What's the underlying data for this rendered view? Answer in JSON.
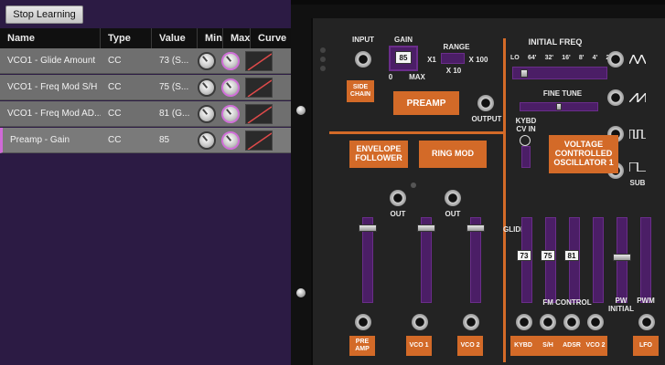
{
  "toolbar": {
    "stop_learning_label": "Stop Learning"
  },
  "table": {
    "headers": {
      "name": "Name",
      "type": "Type",
      "value": "Value",
      "min": "Min",
      "max": "Max",
      "curve": "Curve"
    },
    "rows": [
      {
        "name": "VCO1 - Glide Amount",
        "type": "CC",
        "value": "73 (S..."
      },
      {
        "name": "VCO1 - Freq Mod S/H ...",
        "type": "CC",
        "value": "75 (S..."
      },
      {
        "name": "VCO1 - Freq Mod AD...",
        "type": "CC",
        "value": "81 (G..."
      },
      {
        "name": "Preamp - Gain",
        "type": "CC",
        "value": "85"
      }
    ]
  },
  "synth": {
    "input_label": "INPUT",
    "gain_label": "GAIN",
    "gain_value": "85",
    "gain_min": "0",
    "gain_max": "MAX",
    "range_label": "RANGE",
    "range_x1": "X1",
    "range_x100": "X 100",
    "range_x10": "X 10",
    "side_chain_label": "SIDE CHAIN",
    "preamp_label": "PREAMP",
    "output_label": "OUTPUT",
    "initial_freq_label": "INITIAL FREQ",
    "freq_marks": [
      "LO",
      "64'",
      "32'",
      "16'",
      "8'",
      "4'",
      "2'"
    ],
    "fine_tune_label": "FINE TUNE",
    "kybd_cv_in_label": "KYBD CV IN",
    "vco_label": "VOLTAGE CONTROLLED OSCILLATOR 1",
    "sub_label": "SUB",
    "envelope_follower_label": "ENVELOPE FOLLOWER",
    "ring_mod_label": "RING MOD",
    "out_label_1": "OUT",
    "out_label_2": "OUT",
    "glide_label": "GLIDE",
    "glide_values": [
      "73",
      "75",
      "81"
    ],
    "fm_control_label": "FM CONTROL",
    "pw_initial_label": "PW INITIAL",
    "pwm_label": "PWM",
    "bottom_jacks": [
      "PRE AMP",
      "VCO 1",
      "VCO 2",
      "KYBD",
      "S/H",
      "ADSR",
      "VCO 2",
      "LFO"
    ]
  }
}
